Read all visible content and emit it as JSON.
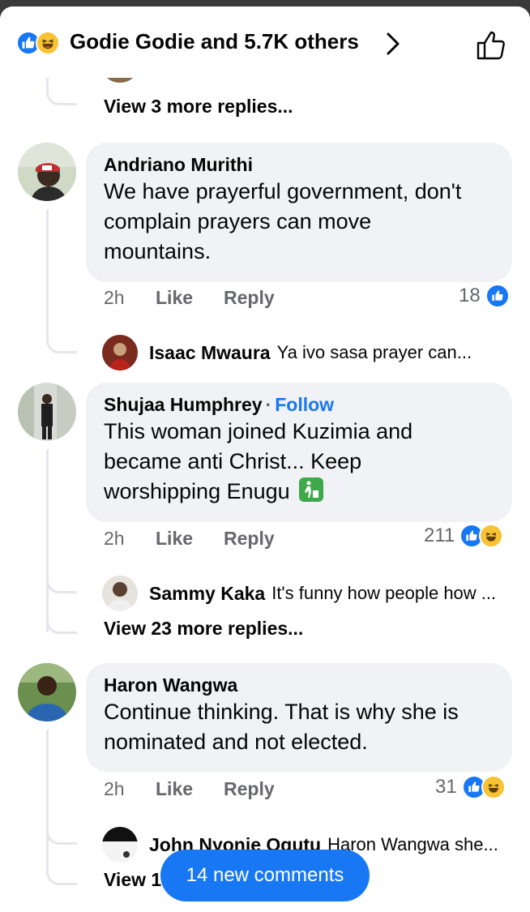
{
  "header": {
    "title": "Godie Godie and 5.7K others",
    "reactions": [
      "like-icon",
      "haha-icon"
    ]
  },
  "colors": {
    "accent": "#1877f2",
    "bubble": "#f0f2f5",
    "secondary": "#65676b",
    "haha": "#f7c233"
  },
  "top_thread": {
    "view_more": "View 3 more replies..."
  },
  "comments": [
    {
      "author": "Andriano Murithi",
      "text_lines": [
        "We have prayerful government, don't",
        "complain prayers can move",
        "mountains."
      ],
      "time": "2h",
      "like": "Like",
      "reply": "Reply",
      "reaction_count": "18",
      "latest_reply": {
        "author": "Isaac Mwaura",
        "text": "Ya ivo sasa  prayer  can..."
      }
    },
    {
      "author": "Shujaa Humphrey",
      "follow": "Follow",
      "text_lines": [
        "This woman joined Kuzimia and",
        "became anti Christ... Keep",
        "worshipping Enugu"
      ],
      "time": "2h",
      "like": "Like",
      "reply": "Reply",
      "reaction_count": "211",
      "latest_reply": {
        "author": "Sammy Kaka",
        "text": "It's funny how people how ..."
      },
      "view_more": "View 23 more replies..."
    },
    {
      "author": "Haron Wangwa",
      "text_lines": [
        "Continue thinking. That is why she is",
        "nominated and not elected."
      ],
      "time": "2h",
      "like": "Like",
      "reply": "Reply",
      "reaction_count": "31",
      "latest_reply": {
        "author": "John Nyonje Ogutu",
        "text": "Haron Wangwa she..."
      },
      "view_more": "View 1"
    }
  ],
  "new_comments": "14 new comments"
}
